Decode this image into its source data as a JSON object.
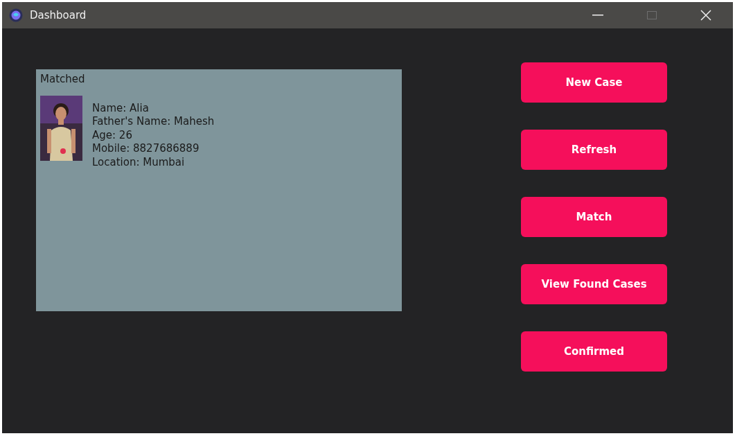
{
  "window": {
    "title": "Dashboard",
    "controls": [
      {
        "kind": "minimize",
        "disabled": false
      },
      {
        "kind": "maximize",
        "disabled": true
      },
      {
        "kind": "close",
        "disabled": false
      }
    ]
  },
  "matched_panel": {
    "title": "Matched",
    "records": [
      {
        "lines": [
          "Name: Alia",
          "Father's Name: Mahesh",
          "Age: 26",
          "Mobile: 8827686889",
          "Location: Mumbai"
        ]
      }
    ]
  },
  "buttons": [
    "New Case",
    "Refresh",
    "Match",
    "View Found Cases",
    "Confirmed"
  ]
}
